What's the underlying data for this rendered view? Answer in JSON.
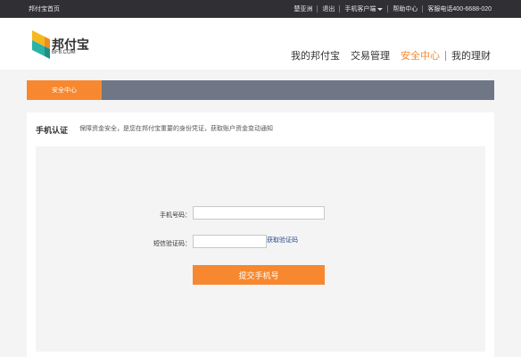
{
  "topbar": {
    "home_link": "邦付宝首页",
    "user": "楚亚洲",
    "logout": "退出",
    "mobile_client": "手机客户端",
    "help": "帮助中心",
    "hotline": "客服电话400-6688-020"
  },
  "header": {
    "logo_name": "邦付宝",
    "logo_domain": "BF8.COM",
    "nav": [
      "我的邦付宝",
      "交易管理",
      "安全中心",
      "我的理财"
    ],
    "active_nav": "安全中心"
  },
  "tabbar": {
    "active_tab": "安全中心"
  },
  "section": {
    "title": "手机认证",
    "description": "保障资金安全，是您在邦付宝重要的身份凭证，获取账户资金变动通知"
  },
  "form": {
    "phone_label": "手机号码：",
    "phone_value": "",
    "sms_label": "短信验证码：",
    "sms_value": "",
    "get_code_link": "获取验证码",
    "submit_label": "提交手机号"
  },
  "colors": {
    "accent": "#f7882f",
    "topbar": "#2f2f34",
    "tabbar": "#6f7686"
  }
}
